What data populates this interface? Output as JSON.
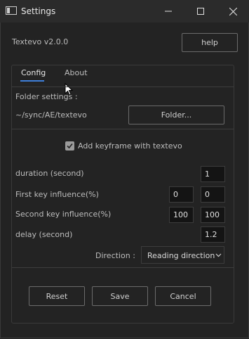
{
  "window": {
    "title": "Settings"
  },
  "header": {
    "version": "Textevo v2.0.0",
    "help_label": "help"
  },
  "tabs": [
    {
      "label": "Config"
    },
    {
      "label": "About"
    }
  ],
  "folder": {
    "heading": "Folder settings :",
    "path": "~/sync/AE/textevo",
    "button_label": "Folder..."
  },
  "keyframe": {
    "label": "Add keyframe with textevo",
    "checked": true
  },
  "settings": {
    "duration": {
      "label": "duration (second)",
      "value": "1"
    },
    "first_key": {
      "label": "First key influence(%)",
      "value1": "0",
      "value2": "0"
    },
    "second_key": {
      "label": "Second key influence(%)",
      "value1": "100",
      "value2": "100"
    },
    "delay": {
      "label": "delay (second)",
      "value": "1.2"
    },
    "direction": {
      "label": "Direction :",
      "selected": "Reading direction"
    }
  },
  "footer": {
    "reset_label": "Reset",
    "save_label": "Save",
    "cancel_label": "Cancel"
  },
  "colors": {
    "background": "#232323",
    "titlebar": "#2b2b2b",
    "tab_accent": "#3f7fd9",
    "field_bg": "#141414"
  }
}
